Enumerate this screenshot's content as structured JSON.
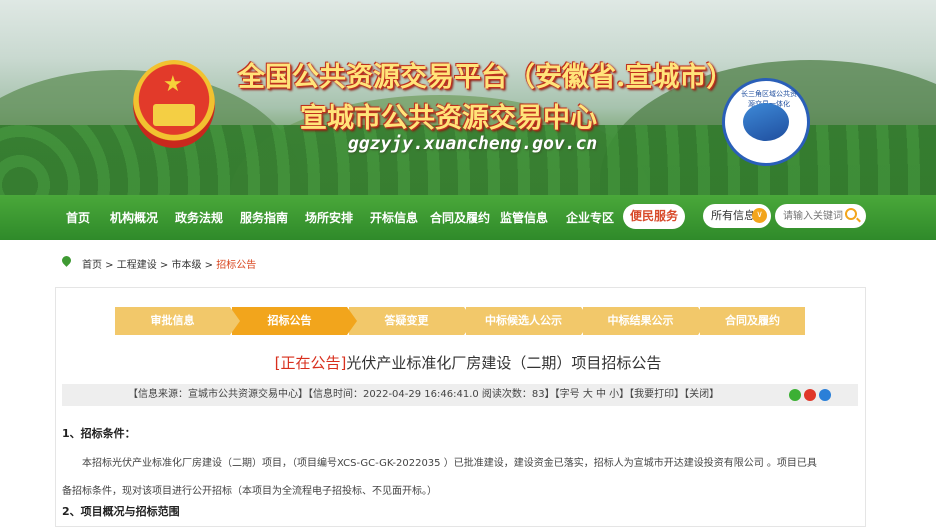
{
  "banner": {
    "title_line1": "全国公共资源交易平台（安徽省.宣城市）",
    "title_line2": "宣城市公共资源交易中心",
    "domain": "ggzyjy.xuancheng.gov.cn",
    "logo_text": "长三角区域公共资源交易一体化"
  },
  "nav": {
    "items": [
      "首页",
      "机构概况",
      "政务法规",
      "服务指南",
      "场所安排",
      "开标信息",
      "合同及履约",
      "监管信息",
      "企业专区"
    ],
    "special": "便民服务",
    "select_value": "所有信息",
    "search_placeholder": "请输入关键词"
  },
  "breadcrumb": {
    "home": "首页",
    "level2": "工程建设",
    "level3": "市本级",
    "current": "招标公告",
    "sep": " > "
  },
  "steps": [
    "审批信息",
    "招标公告",
    "答疑变更",
    "中标候选人公示",
    "中标结果公示",
    "合同及履约"
  ],
  "active_step": 1,
  "article": {
    "status": "[正在公告]",
    "title": "光伏产业标准化厂房建设（二期）项目招标公告",
    "meta": "【信息来源：宣城市公共资源交易中心】【信息时间：2022-04-29 16:46:41.0 阅读次数：83】【字号 大 中 小】【我要打印】【关闭】",
    "section1": "1、招标条件：",
    "para1_line1": "本招标光伏产业标准化厂房建设（二期）项目，（项目编号XCS-GC-GK-2022035 ）已批准建设，建设资金已落实，招标人为宣城市开达建设投资有限公司 。项目已具",
    "para1_line2": "备招标条件，现对该项目进行公开招标（本项目为全流程电子招投标、不见面开标。）",
    "section2": "2、项目概况与招标范围"
  },
  "colors": {
    "nav_green": "#2f8a2a",
    "accent_orange": "#f2a51c",
    "status_red": "#d8301e"
  }
}
